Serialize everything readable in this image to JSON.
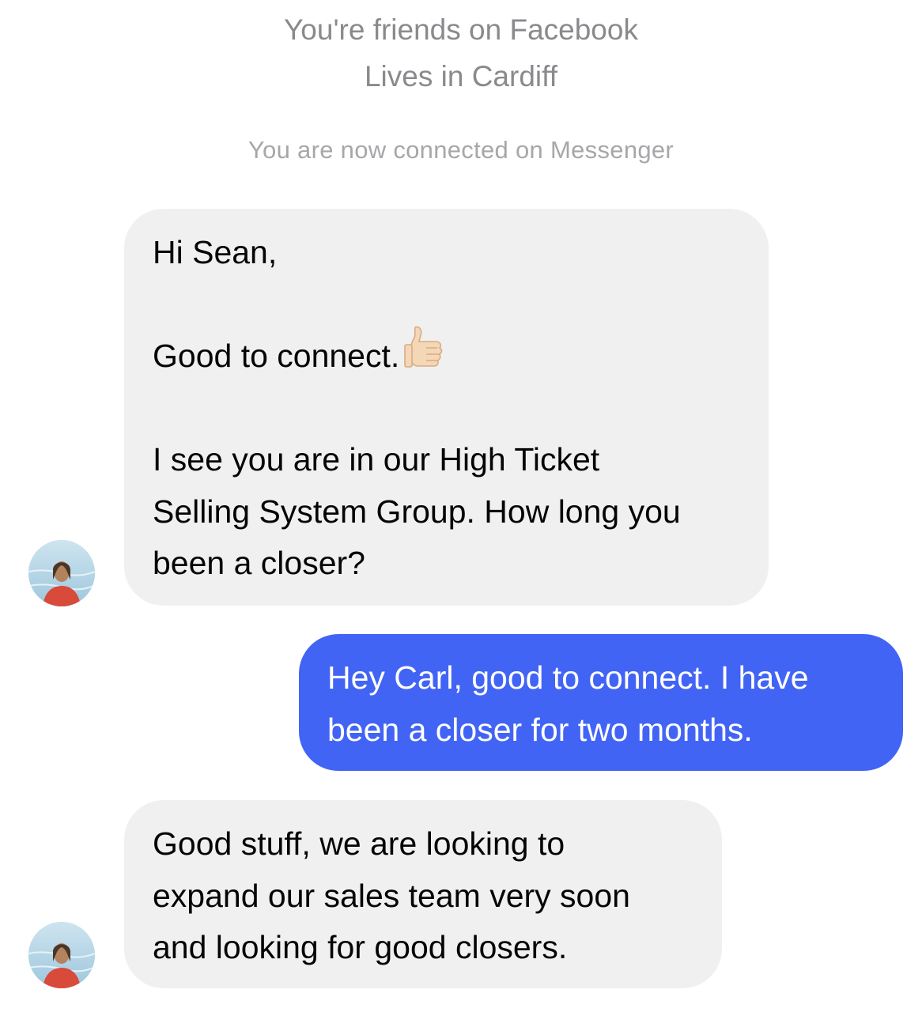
{
  "profile_info": {
    "friends_text": "You're friends on Facebook",
    "location_text": "Lives in Cardiff"
  },
  "system_message": "You are now connected on Messenger",
  "messages": [
    {
      "sender": "contact",
      "lines": [
        "Hi Sean,",
        "",
        "Good to connect.",
        "",
        "I see you are in our High Ticket",
        "Selling System Group. How long you",
        "been a closer?"
      ],
      "emoji": "thumbs-up-icon"
    },
    {
      "sender": "me",
      "lines": [
        "Hey Carl, good to connect. I have",
        "been a closer for two months."
      ]
    },
    {
      "sender": "contact",
      "lines": [
        "Good stuff, we are looking to",
        "expand our sales team very soon",
        "and looking for good closers."
      ]
    }
  ],
  "colors": {
    "incoming_bubble": "#f0f0f0",
    "outgoing_bubble": "#4264f5",
    "meta_text": "#8a8a8e"
  }
}
